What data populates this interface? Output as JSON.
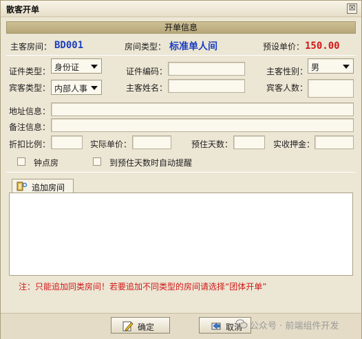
{
  "window": {
    "title": "散客开单",
    "close_glyph": "☒"
  },
  "section": {
    "title": "开单信息"
  },
  "summary": {
    "room_label": "主客房间：",
    "room_value": "BD001",
    "type_label": "房间类型：",
    "type_value": "标准单人间",
    "price_label": "预设单价：",
    "price_value": "150.00"
  },
  "form": {
    "id_type_label": "证件类型：",
    "id_type_value": "身份证",
    "id_no_label": "证件编码：",
    "id_no_value": "",
    "gender_label": "主客性别：",
    "gender_value": "男",
    "guest_type_label": "宾客类型：",
    "guest_type_value": "内部人事",
    "name_label": "主客姓名：",
    "name_value": "",
    "count_label": "宾客人数：",
    "count_value": "",
    "address_label": "地址信息：",
    "address_value": "",
    "remark_label": "备注信息：",
    "remark_value": "",
    "discount_label": "折扣比例：",
    "discount_value": "",
    "actual_price_label": "实际单价：",
    "actual_price_value": "",
    "days_label": "预住天数：",
    "days_value": "",
    "deposit_label": "实收押金：",
    "deposit_value": "",
    "hourly_label": "钟点房",
    "remind_label": "到预住天数时自动提醒"
  },
  "tab": {
    "label": "追加房间",
    "icon": "add-room-icon"
  },
  "note": "注：只能追加同类房间！若要追加不同类型的房间请选择“团体开单”",
  "buttons": {
    "ok": "确定",
    "cancel": "取消"
  },
  "watermark": "公众号 · 前端组件开发",
  "colors": {
    "value_blue": "#1b3fc0",
    "value_red": "#d01818",
    "header_bg": "#c4b586",
    "window_bg": "#ece6d4"
  }
}
